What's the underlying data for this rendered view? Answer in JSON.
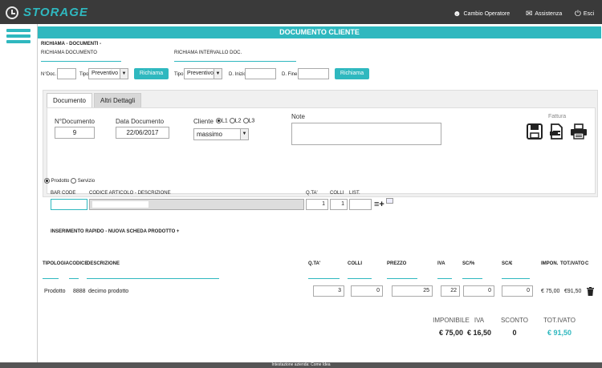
{
  "app": {
    "title": "STORAGE"
  },
  "topbar": {
    "operator": "Cambio Operatore",
    "assistance": "Assistenza",
    "exit": "Esci"
  },
  "page": {
    "title": "DOCUMENTO CLIENTE"
  },
  "recall": {
    "section_title": "RICHIAMA - DOCUMENTI -",
    "doc_label": "RICHIAMA DOCUMENTO",
    "interval_label": "RICHIAMA INTERVALLO DOC.",
    "ndoc_label": "N°Doc.",
    "ndoc_value": "",
    "tipo_label": "Tipo",
    "tipo_value": "Preventivo",
    "recall_button": "Richiama",
    "tipo2_label": "Tipo",
    "tipo2_value": "Preventivo",
    "dinizio_label": "D. Inizio",
    "dfine_label": "D. Fine",
    "recall_button2": "Richiama"
  },
  "tabs": [
    {
      "label": "Documento"
    },
    {
      "label": "Altri Dettagli"
    }
  ],
  "document": {
    "ndoc_label": "N°Documento",
    "ndoc_value": "9",
    "date_label": "Data Documento",
    "date_value": "22/06/2017",
    "client_label": "Cliente",
    "l1": "L1",
    "l2": "L2",
    "l3": "L3",
    "client_value": "massimo",
    "note_label": "Note",
    "invoice_label": "Fattura"
  },
  "product": {
    "prodotto_label": "Prodotto",
    "servizio_label": "Servizio",
    "barcode_label": "BAR CODE",
    "code_label": "CODICE ARTICOLO - DESCRIZIONE",
    "qty_label": "Q.TA'",
    "colli_label": "COLLI",
    "list_label": "LIST.",
    "qty_value": "1",
    "colli_value": "1",
    "quick_insert": "INSERIMENTO RAPIDO - NUOVA SCHEDA PRODOTTO +"
  },
  "table": {
    "headers": [
      "TIPOLOGIA",
      "CODICE",
      "DESCRIZIONE",
      "Q.TA'",
      "COLLI",
      "PREZZO",
      "IVA",
      "SC/%",
      "SC/€",
      "IMPON.",
      "TOT.IVATO",
      "C"
    ],
    "row": {
      "tipologia": "Prodotto",
      "codice": "8888",
      "descrizione": "decimo prodotto",
      "qta": "3",
      "colli": "0",
      "prezzo": "25",
      "iva": "22",
      "sc_perc": "0",
      "sc_eur": "0",
      "impon": "€ 75,00",
      "tot_ivato": "€91,50"
    }
  },
  "summary": {
    "imponibile_label": "IMPONIBILE",
    "iva_label": "IVA",
    "sconto_label": "SCONTO",
    "totivato_label": "TOT.IVATO",
    "imponibile_value": "€ 75,00",
    "iva_value": "€ 16,50",
    "sconto_value": "0",
    "totivato_value": "€ 91,50"
  },
  "footer": {
    "text": "Intestazione azienda: Come Idea"
  },
  "colors": {
    "accent": "#2fb8bf",
    "topbar": "#3a3a3a"
  }
}
